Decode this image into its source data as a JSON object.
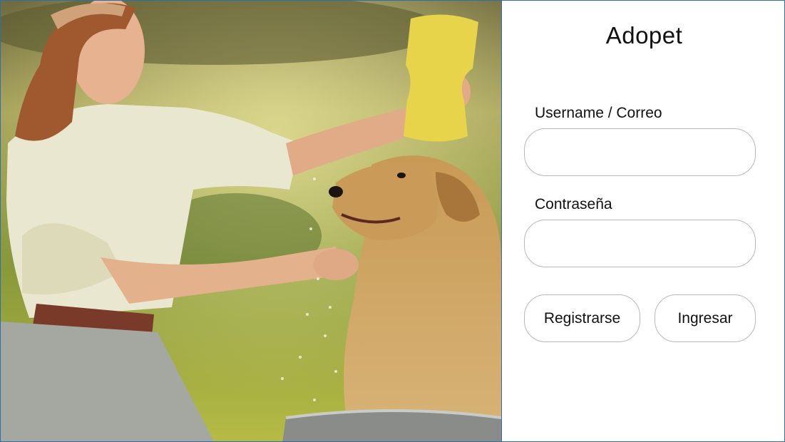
{
  "app": {
    "title": "Adopet"
  },
  "hero": {
    "image": "woman-bathing-golden-retriever-photo"
  },
  "login": {
    "username_label": "Username / Correo",
    "username_value": "",
    "password_label": "Contraseña",
    "password_value": "",
    "register_label": "Registrarse",
    "login_label": "Ingresar"
  },
  "colors": {
    "window_border": "#2e6fa8",
    "field_border": "#b8b8b8",
    "background": "#ffffff"
  }
}
